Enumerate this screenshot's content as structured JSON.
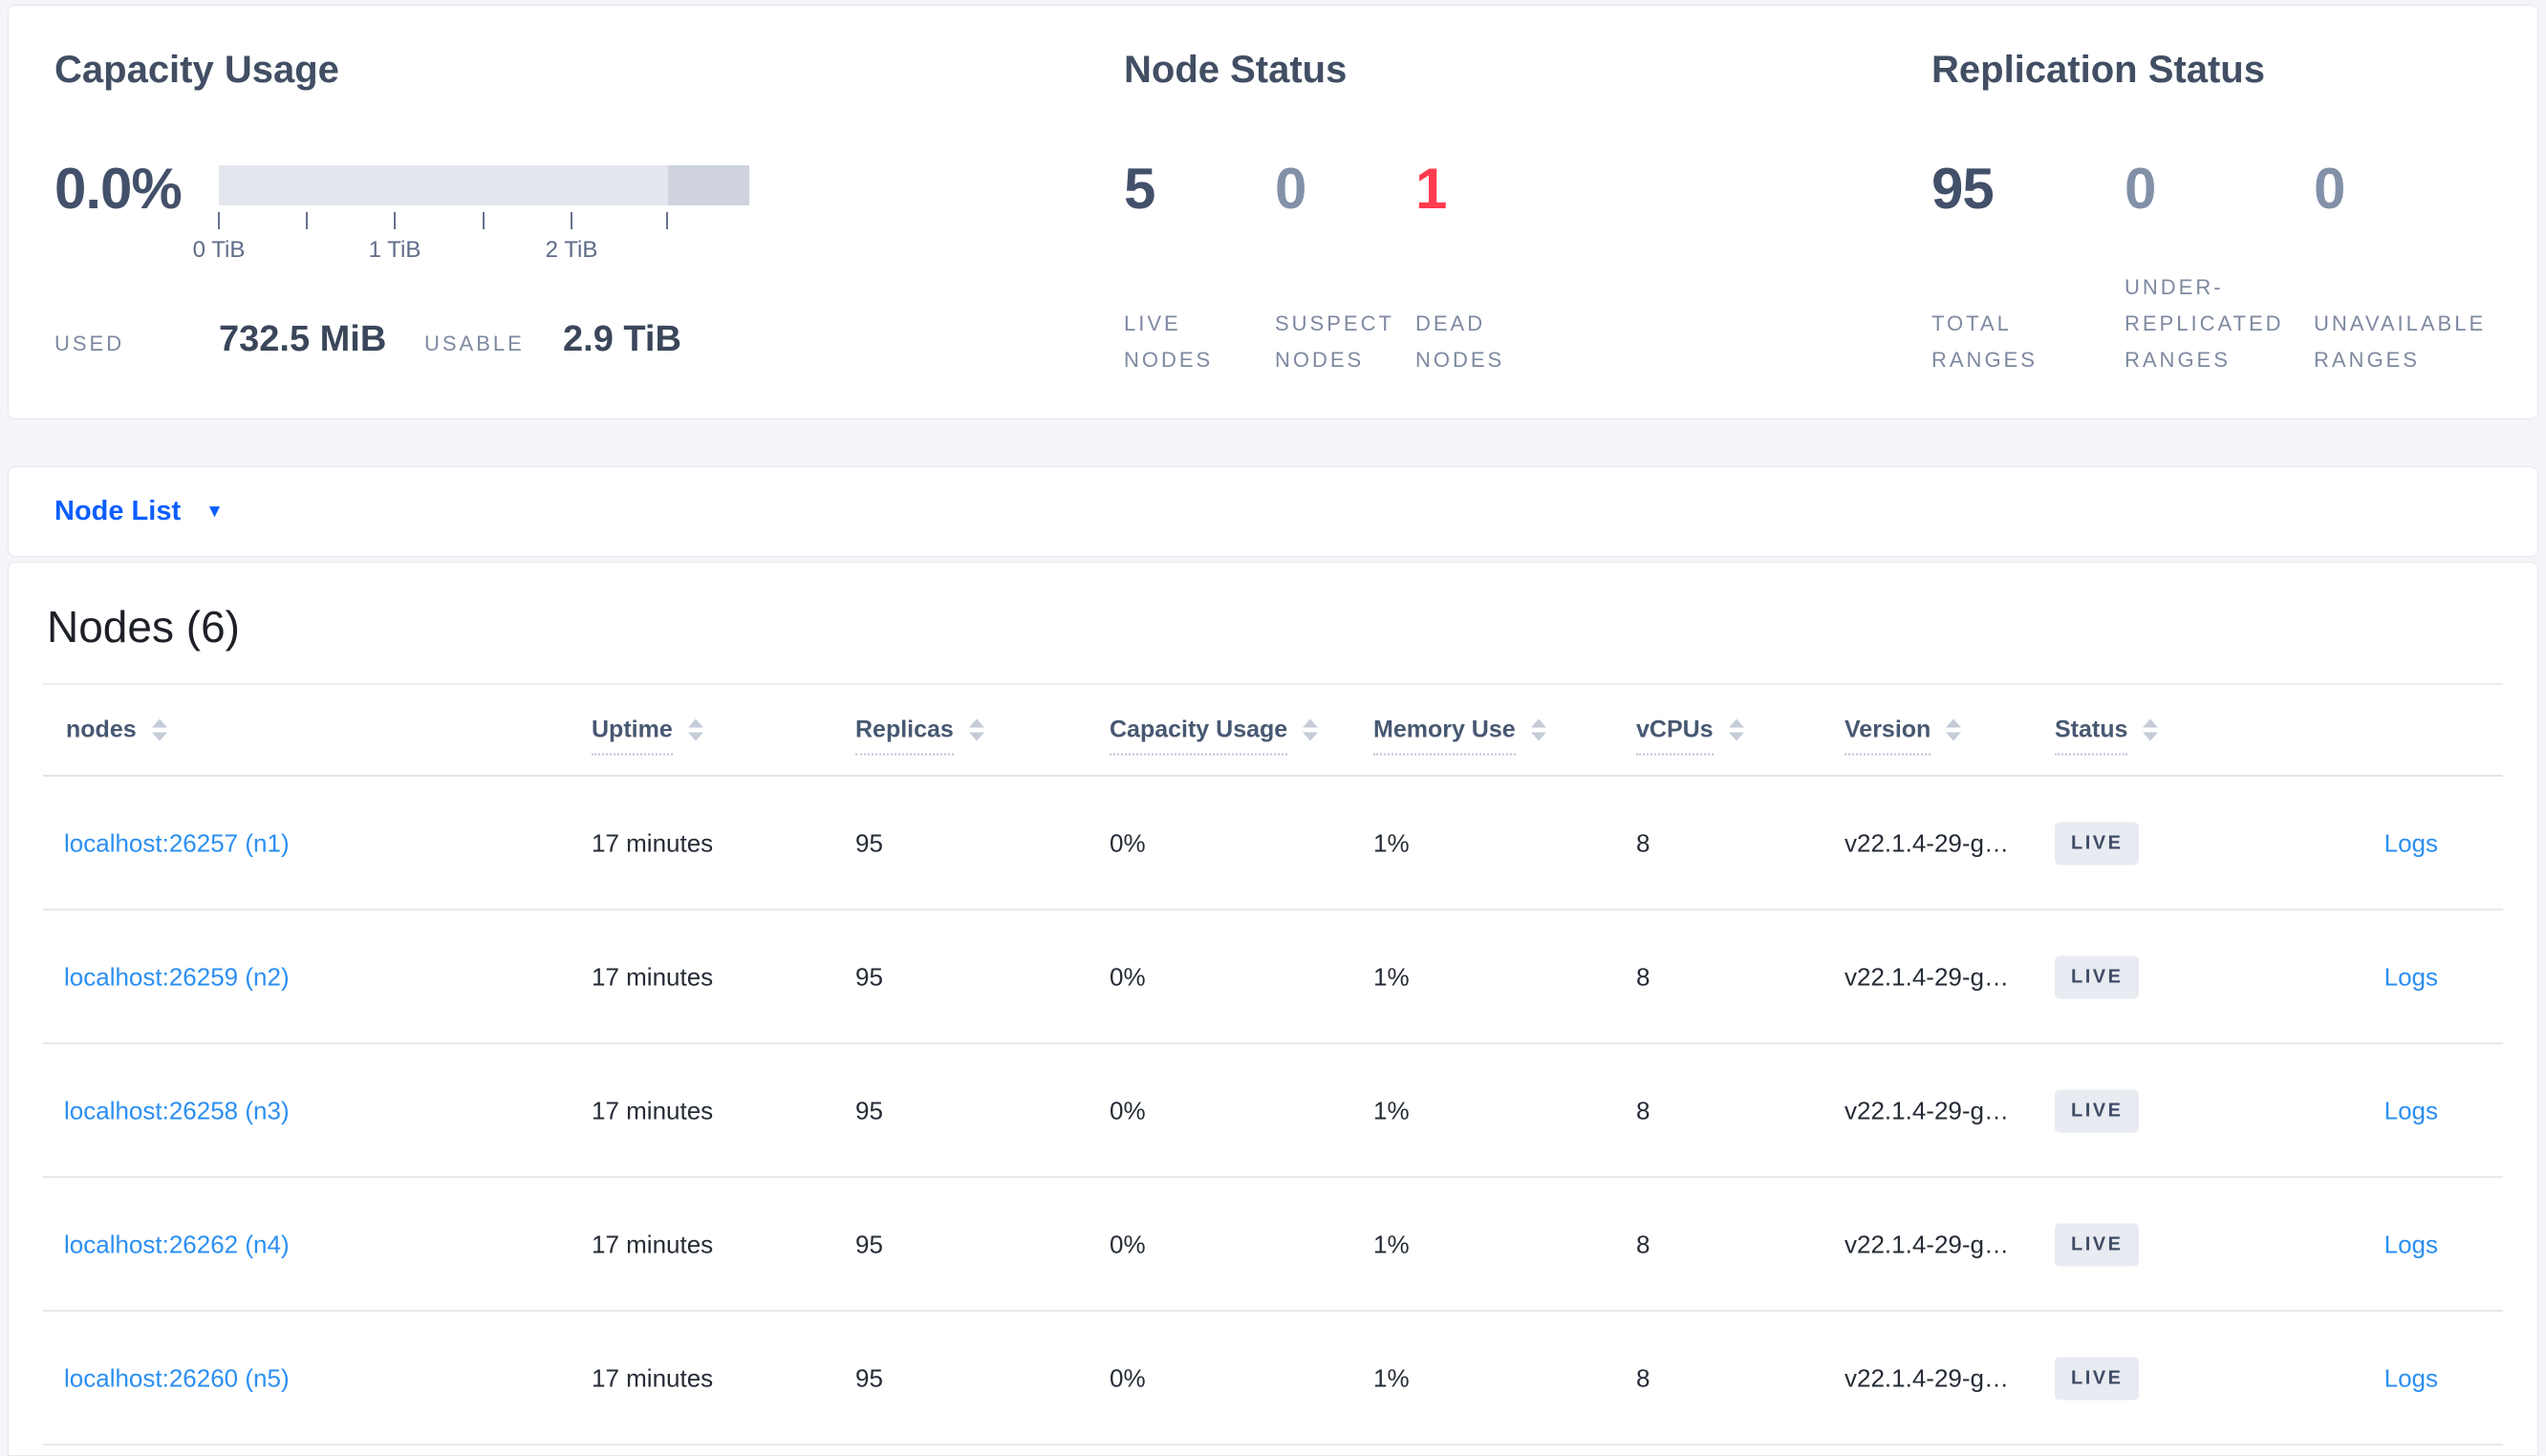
{
  "colors": {
    "page_bg": "#f4f5f9",
    "card_bg": "#ffffff",
    "title_text": "#414e63",
    "stat_dark": "#43506a",
    "stat_muted": "#8290a8",
    "stat_danger": "#ff3b4f",
    "small_label": "#7e89a0",
    "primary_link": "#0a5eff",
    "row_link": "#2b8ff2",
    "badge_bg": "#e8ebf1",
    "capacity_bar_light": "#e3e6ed",
    "capacity_bar_dark": "#ced3de",
    "row_divider": "#e6e9ee"
  },
  "overview": {
    "capacity": {
      "title": "Capacity Usage",
      "percent": "0.0%",
      "bar": {
        "light_fraction": 0.85,
        "dark_fraction": 0.15
      },
      "axis_ticks": [
        "0 TiB",
        "1 TiB",
        "2 TiB"
      ],
      "used_label": "USED",
      "used_value": "732.5 MiB",
      "usable_label": "USABLE",
      "usable_value": "2.9 TiB"
    },
    "node_status": {
      "title": "Node Status",
      "stats": [
        {
          "value": "5",
          "label": "LIVE NODES",
          "tone": "dark"
        },
        {
          "value": "0",
          "label": "SUSPECT NODES",
          "tone": "muted"
        },
        {
          "value": "1",
          "label": "DEAD NODES",
          "tone": "danger"
        }
      ]
    },
    "replication": {
      "title": "Replication Status",
      "stats": [
        {
          "value": "95",
          "label": "TOTAL RANGES",
          "tone": "dark"
        },
        {
          "value": "0",
          "label": "UNDER-REPLICATED RANGES",
          "tone": "muted"
        },
        {
          "value": "0",
          "label": "UNAVAILABLE RANGES",
          "tone": "muted"
        }
      ]
    }
  },
  "view_selector": {
    "label": "Node List",
    "caret_icon": "▼"
  },
  "nodes_table": {
    "heading": "Nodes (6)",
    "columns": [
      {
        "label": "nodes"
      },
      {
        "label": "Uptime"
      },
      {
        "label": "Replicas"
      },
      {
        "label": "Capacity Usage"
      },
      {
        "label": "Memory Use"
      },
      {
        "label": "vCPUs"
      },
      {
        "label": "Version"
      },
      {
        "label": "Status"
      }
    ],
    "rows": [
      {
        "node": "localhost:26257 (n1)",
        "uptime": "17 minutes",
        "replicas": "95",
        "capacity_usage": "0%",
        "memory_use": "1%",
        "vcpus": "8",
        "version": "v22.1.4-29-g…",
        "status": "LIVE",
        "logs": "Logs"
      },
      {
        "node": "localhost:26259 (n2)",
        "uptime": "17 minutes",
        "replicas": "95",
        "capacity_usage": "0%",
        "memory_use": "1%",
        "vcpus": "8",
        "version": "v22.1.4-29-g…",
        "status": "LIVE",
        "logs": "Logs"
      },
      {
        "node": "localhost:26258 (n3)",
        "uptime": "17 minutes",
        "replicas": "95",
        "capacity_usage": "0%",
        "memory_use": "1%",
        "vcpus": "8",
        "version": "v22.1.4-29-g…",
        "status": "LIVE",
        "logs": "Logs"
      },
      {
        "node": "localhost:26262 (n4)",
        "uptime": "17 minutes",
        "replicas": "95",
        "capacity_usage": "0%",
        "memory_use": "1%",
        "vcpus": "8",
        "version": "v22.1.4-29-g…",
        "status": "LIVE",
        "logs": "Logs"
      },
      {
        "node": "localhost:26260 (n5)",
        "uptime": "17 minutes",
        "replicas": "95",
        "capacity_usage": "0%",
        "memory_use": "1%",
        "vcpus": "8",
        "version": "v22.1.4-29-g…",
        "status": "LIVE",
        "logs": "Logs"
      }
    ]
  }
}
